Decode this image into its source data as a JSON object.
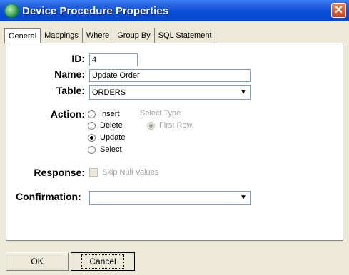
{
  "window": {
    "title": "Device Procedure Properties",
    "close_glyph": "✕"
  },
  "tabs": [
    "General",
    "Mappings",
    "Where",
    "Group By",
    "SQL Statement"
  ],
  "form": {
    "id_label": "ID:",
    "id_value": "4",
    "name_label": "Name:",
    "name_value": "Update Order",
    "table_label": "Table:",
    "table_value": "ORDERS",
    "action_label": "Action:",
    "actions": [
      "Insert",
      "Delete",
      "Update",
      "Select"
    ],
    "selected_action": "Update",
    "select_type_label": "Select Type",
    "first_row_label": "First Row",
    "response_label": "Response:",
    "skip_null_label": "Skip Null Values",
    "confirmation_label": "Confirmation:",
    "confirmation_value": ""
  },
  "buttons": {
    "ok": "OK",
    "cancel": "Cancel"
  },
  "icons": {
    "title": "app-icon",
    "dropdown": "chevron-down-icon"
  }
}
